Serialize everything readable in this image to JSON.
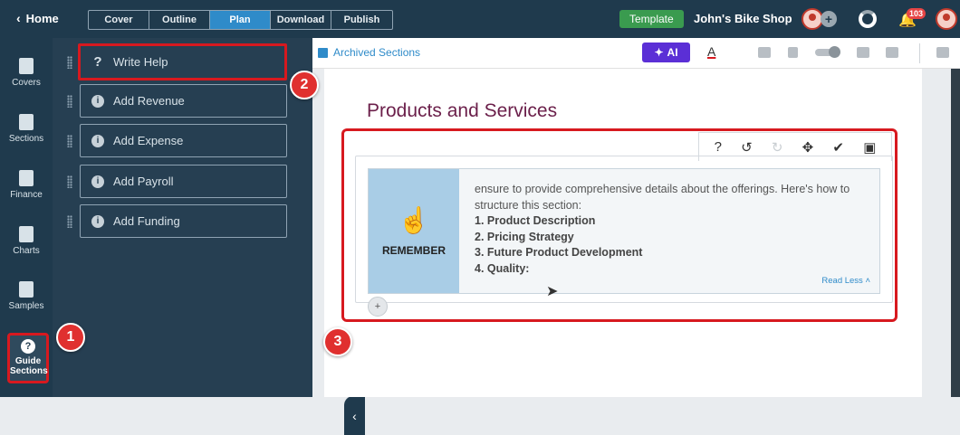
{
  "topbar": {
    "home_label": "Home",
    "tabs": [
      {
        "label": "Cover"
      },
      {
        "label": "Outline"
      },
      {
        "label": "Plan"
      },
      {
        "label": "Download"
      },
      {
        "label": "Publish"
      }
    ],
    "active_tab": "Plan",
    "template_label": "Template",
    "company_name": "John's Bike Shop",
    "notification_count": "103",
    "colors": {
      "bar": "#1f3a4d",
      "active_tab": "#2f8bc9",
      "template": "#3a9b4f"
    }
  },
  "left_nav": {
    "items": [
      {
        "label": "Covers",
        "icon": "covers-icon"
      },
      {
        "label": "Sections",
        "icon": "sections-icon"
      },
      {
        "label": "Finance",
        "icon": "finance-icon"
      },
      {
        "label": "Charts",
        "icon": "charts-icon"
      },
      {
        "label": "Samples",
        "icon": "samples-icon"
      }
    ],
    "guide_line1": "Guide",
    "guide_line2": "Sections"
  },
  "help_panel": {
    "items": [
      {
        "label": "Write Help",
        "icon": "question-icon"
      },
      {
        "label": "Add Revenue",
        "icon": "info-icon"
      },
      {
        "label": "Add Expense",
        "icon": "info-icon"
      },
      {
        "label": "Add Payroll",
        "icon": "info-icon"
      },
      {
        "label": "Add Funding",
        "icon": "info-icon"
      }
    ]
  },
  "markers": [
    "1",
    "2",
    "3"
  ],
  "toolbar": {
    "archived_label": "Archived Sections",
    "ai_label": "AI",
    "font_color_label": "A"
  },
  "document": {
    "section_title": "Products and Services",
    "remember_label": "REMEMBER",
    "body_intro": "ensure to provide comprehensive details about the offerings. Here's how to structure this section:",
    "points": [
      "1. Product Description",
      "2. Pricing Strategy",
      "3. Future Product Development",
      "4. Quality:"
    ],
    "read_less": "Read Less"
  }
}
